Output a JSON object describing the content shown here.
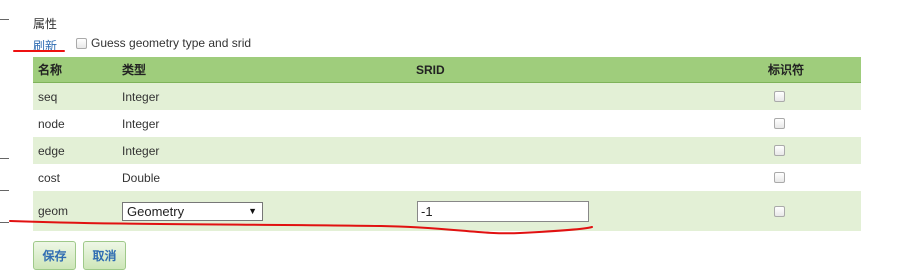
{
  "properties": {
    "title": "属性",
    "refresh_label": "刷新",
    "guess_label": "Guess geometry type and srid"
  },
  "table": {
    "headers": {
      "name": "名称",
      "type": "类型",
      "srid": "SRID",
      "identifier": "标识符"
    },
    "rows": [
      {
        "name": "seq",
        "type": "Integer",
        "identifier_checked": false
      },
      {
        "name": "node",
        "type": "Integer",
        "identifier_checked": false
      },
      {
        "name": "edge",
        "type": "Integer",
        "identifier_checked": false
      },
      {
        "name": "cost",
        "type": "Double",
        "identifier_checked": false
      }
    ],
    "edit_row": {
      "name": "geom",
      "type_selected": "Geometry",
      "srid_value": "-1",
      "identifier_checked": false
    }
  },
  "buttons": {
    "save": "保存",
    "cancel": "取消"
  },
  "colors": {
    "header_green": "#9fcd7c",
    "row_green": "#e3f0d6",
    "link_blue": "#2f6cb2",
    "annotation_red": "#e11111"
  }
}
